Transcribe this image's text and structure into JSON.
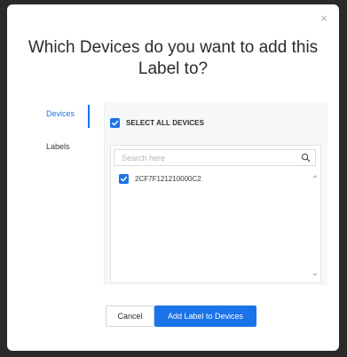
{
  "dialog": {
    "title": "Which Devices do you want to add this Label to?",
    "close_symbol": "×"
  },
  "tabs": [
    {
      "label": "Devices",
      "active": true
    },
    {
      "label": "Labels",
      "active": false
    }
  ],
  "select_all": {
    "label": "SELECT ALL DEVICES",
    "checked": true
  },
  "search": {
    "placeholder": "Search here",
    "value": ""
  },
  "devices": [
    {
      "label": "2CF7F121210000C2",
      "checked": true
    }
  ],
  "buttons": {
    "cancel_label": "Cancel",
    "add_label": "Add Label to Devices"
  },
  "colors": {
    "accent": "#1a73e8",
    "overlay": "#2a2a2a",
    "panel_bg": "#f6f7f9"
  },
  "icons": [
    "close-icon",
    "checkbox-checked-icon",
    "search-icon",
    "scroll-up-icon",
    "scroll-down-icon"
  ]
}
